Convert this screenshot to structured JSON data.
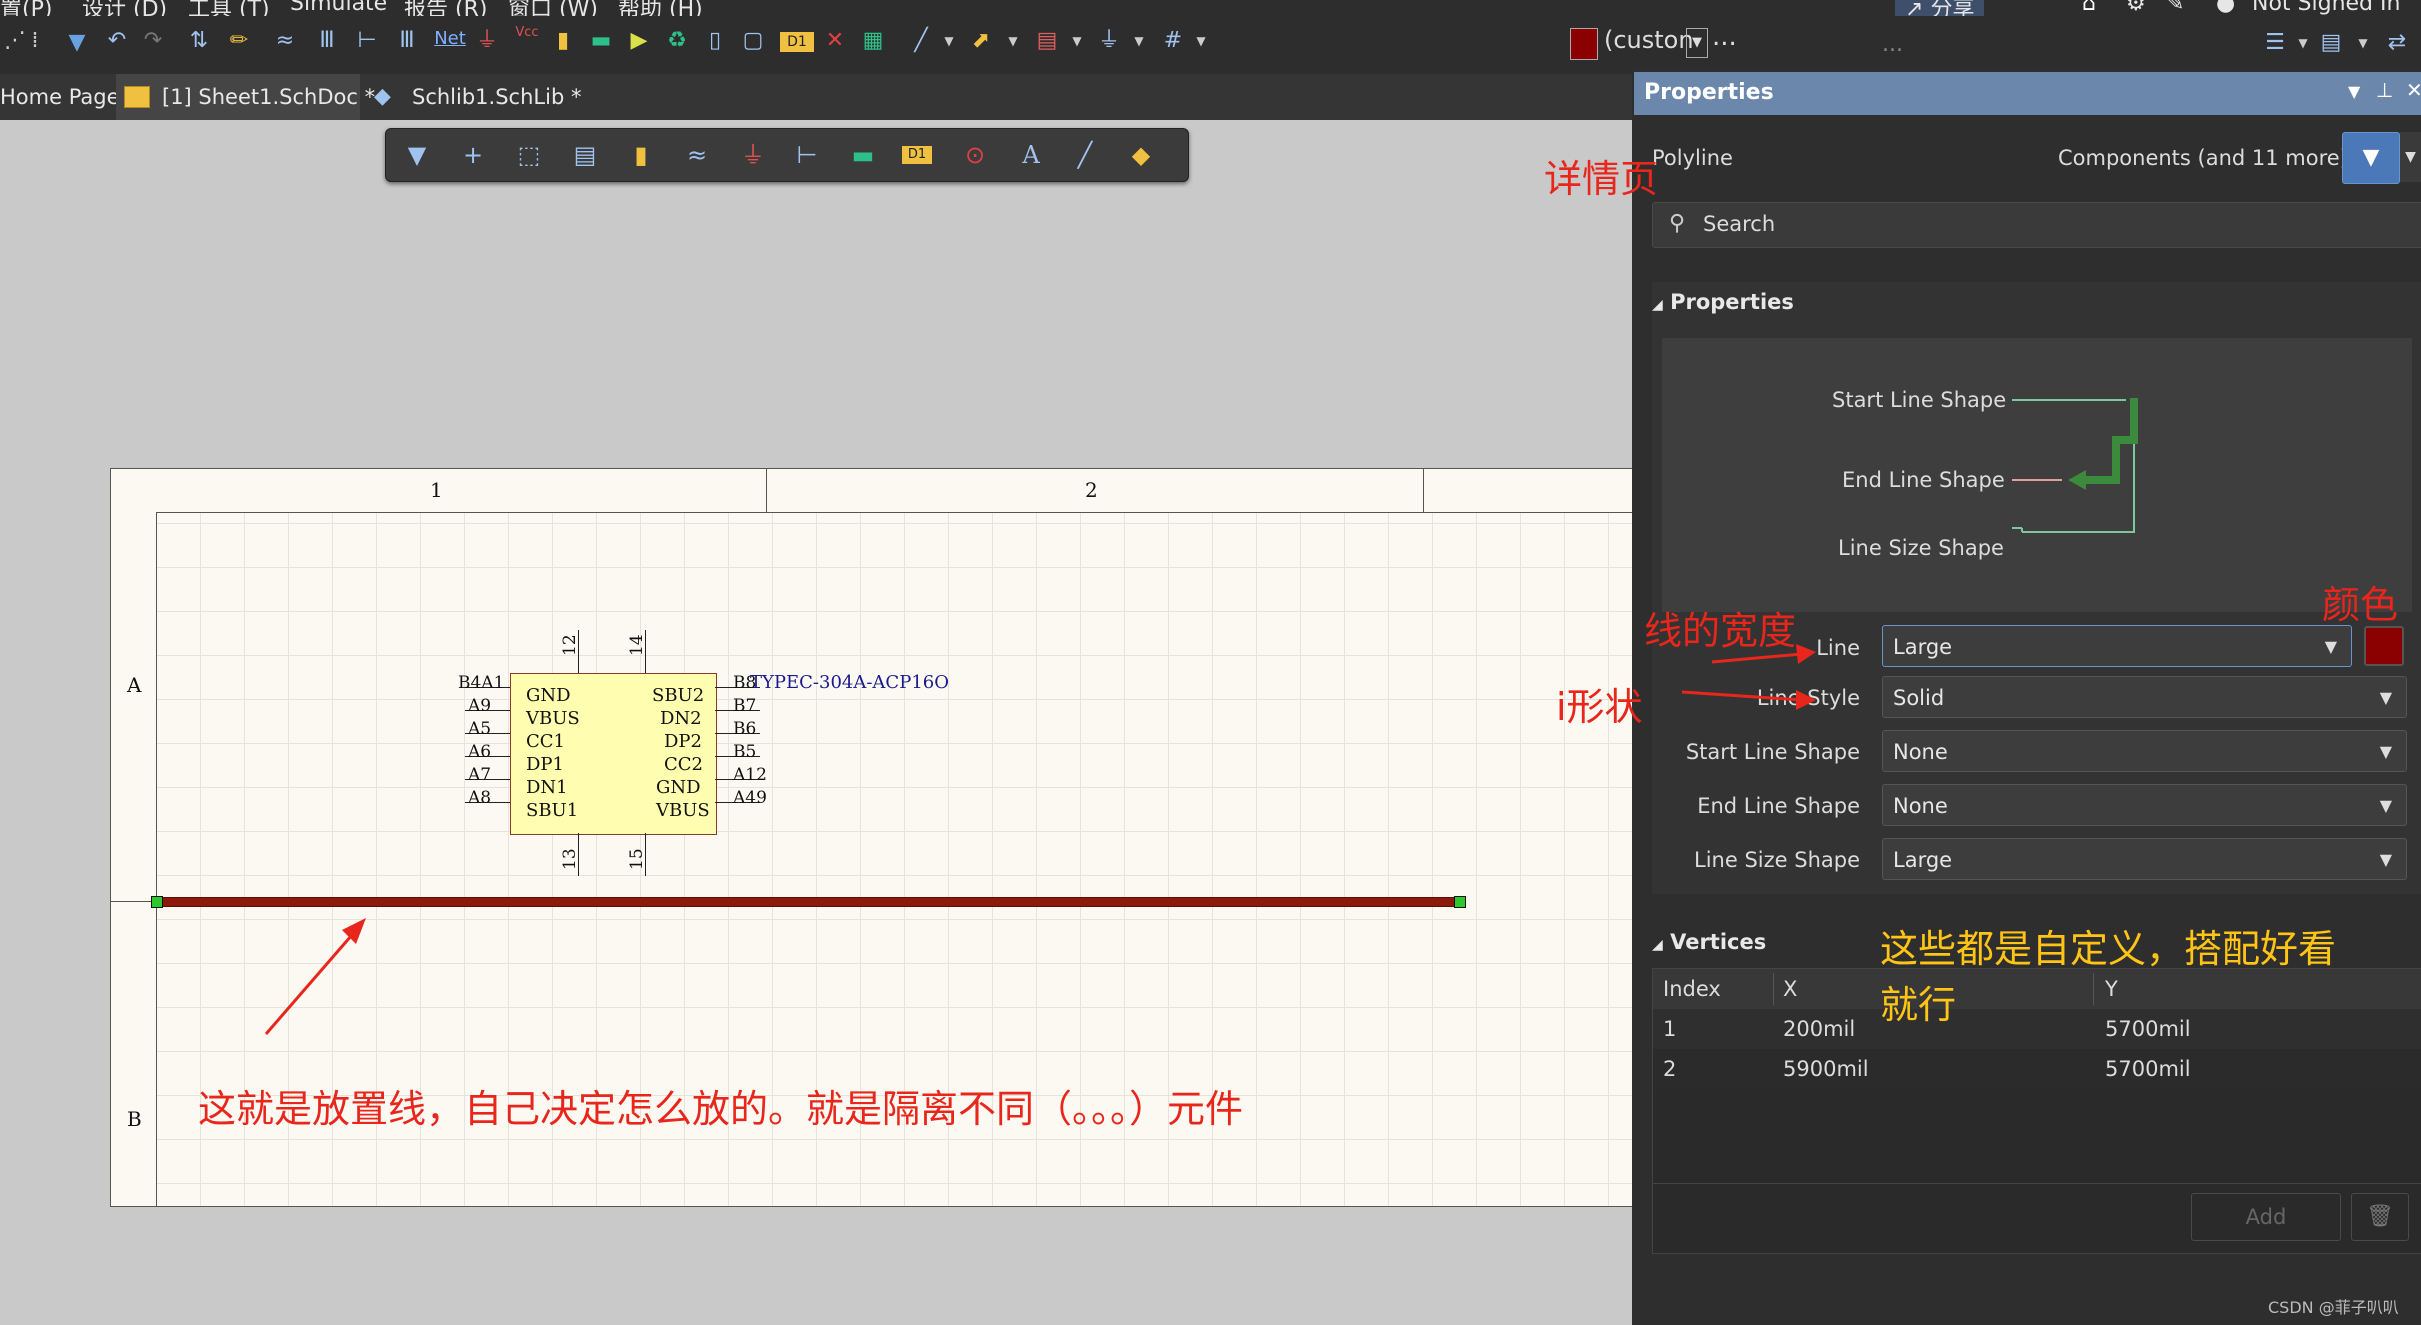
{
  "menu": {
    "items": [
      "置(P)",
      "设计 (D)",
      "工具 (T)",
      "Simulate",
      "报告 (R)",
      "窗口 (W)",
      "帮助 (H)"
    ],
    "right": {
      "share_label": "分享",
      "signed_label": "Not Signed In"
    }
  },
  "toolbar": {
    "net_label": "Net",
    "vcc_label": "Vcc",
    "custom_label": "(custon",
    "ellipsis": "...",
    "dots": "...",
    "color_swatch": "#8b0000"
  },
  "tabs": [
    {
      "label": "Home Page"
    },
    {
      "label": "[1] Sheet1.SchDoc *"
    },
    {
      "label": "Schlib1.SchLib *"
    }
  ],
  "sheet": {
    "columns": [
      "1",
      "2"
    ],
    "rows": [
      "A",
      "B"
    ]
  },
  "component": {
    "name": "TYPEC-304A-ACP16O",
    "left_pins": [
      {
        "num": "B4A1",
        "name": "GND"
      },
      {
        "num": "A9",
        "name": "VBUS"
      },
      {
        "num": "A5",
        "name": "CC1"
      },
      {
        "num": "A6",
        "name": "DP1"
      },
      {
        "num": "A7",
        "name": "DN1"
      },
      {
        "num": "A8",
        "name": "SBU1"
      }
    ],
    "right_pins": [
      {
        "num": "B8",
        "name": "SBU2"
      },
      {
        "num": "B7",
        "name": "DN2"
      },
      {
        "num": "B6",
        "name": "DP2"
      },
      {
        "num": "B5",
        "name": "CC2"
      },
      {
        "num": "A12",
        "name": "GND"
      },
      {
        "num": "A49",
        "name": "VBUS"
      }
    ],
    "top_pins": [
      "12",
      "14"
    ],
    "bottom_pins": [
      "13",
      "15"
    ]
  },
  "polyline": {
    "color": "#8b1a0c"
  },
  "annotations": {
    "main": "这就是放置线，自己决定怎么放的。就是隔离不同（。。。）元件",
    "detail_page": "详情页",
    "line_width": "线的宽度",
    "color": "颜色",
    "shape": "i形状",
    "custom_line1": "这些都是自定义，搭配好看",
    "custom_line2": "就行"
  },
  "panel": {
    "title": "Properties",
    "object_type": "Polyline",
    "filter_label": "Components (and 11 more)",
    "search_placeholder": "Search",
    "properties_section": "Properties",
    "preview": {
      "start_line_shape": "Start Line Shape",
      "end_line_shape": "End Line Shape",
      "line_size_shape": "Line Size Shape"
    },
    "fields": [
      {
        "label": "Line",
        "value": "Large"
      },
      {
        "label": "Line Style",
        "value": "Solid"
      },
      {
        "label": "Start Line Shape",
        "value": "None"
      },
      {
        "label": "End Line Shape",
        "value": "None"
      },
      {
        "label": "Line Size Shape",
        "value": "Large"
      }
    ],
    "line_color": "#8b0000",
    "vertices_section": "Vertices",
    "vertices_headers": [
      "Index",
      "X",
      "Y"
    ],
    "vertices": [
      {
        "index": "1",
        "x": "200mil",
        "y": "5700mil"
      },
      {
        "index": "2",
        "x": "5900mil",
        "y": "5700mil"
      }
    ],
    "add_label": "Add"
  },
  "watermark": "CSDN @菲子叭叭"
}
